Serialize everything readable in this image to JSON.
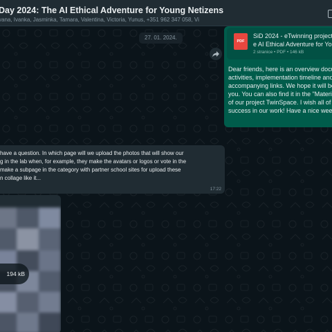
{
  "header": {
    "title": "Day 2024: The AI Ethical Adventure for Young Netizens",
    "members": "vana, Ivanka, Jasminka, Tamara, Valentina, Victoria, Yunus, +351 962 347 058, Vi"
  },
  "date_chip": "27. 01. 2024.",
  "outgoing": {
    "document": {
      "file_name_line1": "SiD 2024 - eTwinning project -",
      "file_name_line2": "e AI Ethical Adventure for Young",
      "meta": "2 stranice • PDF • 146 kB",
      "icon_label": "PDF",
      "icon": "pdf-icon"
    },
    "text_lines": [
      "Dear friends, here is an overview docu",
      "activities, implementation timeline and",
      "accompanying links. We hope it will be",
      "you. You can also find it in the \"Materi",
      "of our project TwinSpace. I wish all of",
      "success in our work! Have a nice week"
    ]
  },
  "incoming": {
    "text_lines": [
      "have a question. In which page will we upload the photos that will show our",
      "g in the lab when, for example, they make the avatars or logos or vote in the",
      "make a subpage in the category with partner school sites for upload these",
      "n collage like it..."
    ],
    "time": "17:22"
  },
  "image_message": {
    "size": "194 kB"
  },
  "icons": {
    "forward": "forward-icon",
    "header_edge": "header-edge-icon"
  },
  "colors": {
    "background": "#0b141a",
    "header": "#202c33",
    "outgoing_bubble": "#005c4b",
    "incoming_bubble": "#202c33",
    "pdf_red": "#e8473f"
  }
}
